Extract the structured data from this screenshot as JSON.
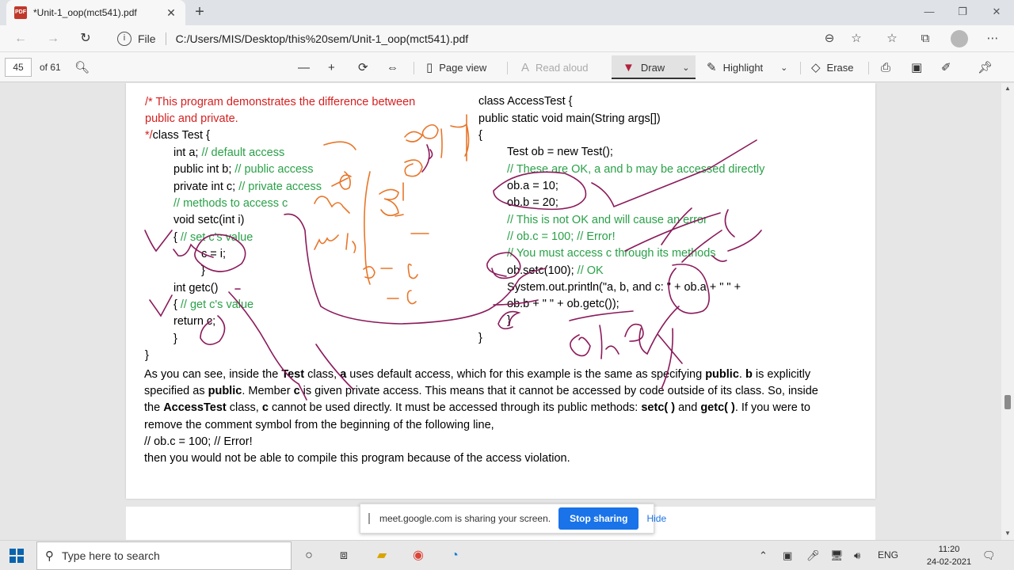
{
  "browser": {
    "tab_title": "*Unit-1_oop(mct541).pdf",
    "tab_icon": "pdf-icon",
    "file_label": "File",
    "url": "C:/Users/MIS/Desktop/this%20sem/Unit-1_oop(mct541).pdf"
  },
  "pdf_toolbar": {
    "page_number": "45",
    "page_count": "of 61",
    "page_view": "Page view",
    "read_aloud": "Read aloud",
    "draw": "Draw",
    "highlight": "Highlight",
    "erase": "Erase"
  },
  "document": {
    "left_code": [
      {
        "text": "/* This program demonstrates the difference between",
        "color": "red"
      },
      {
        "text": "public and private.",
        "color": "red"
      },
      {
        "text": "class Test {",
        "prefix": "*/",
        "color": "black"
      },
      {
        "text": "int a; ",
        "comment": "// default access"
      },
      {
        "text": "public int b; ",
        "comment": "// public access"
      },
      {
        "text": "private int c; ",
        "comment": "// private access"
      },
      {
        "text": "",
        "comment": "// methods to access c"
      },
      {
        "text": "void setc(int i)"
      },
      {
        "text": "{ ",
        "comment": "// set c's value"
      },
      {
        "text": "c = i;"
      },
      {
        "text": "}"
      },
      {
        "text": "int getc()"
      },
      {
        "text": "{ ",
        "comment": "// get c's value"
      },
      {
        "text": "return c;"
      },
      {
        "text": "}"
      },
      {
        "text": "}"
      }
    ],
    "right_code": [
      {
        "text": "class AccessTest {"
      },
      {
        "text": "public static void main(String args[])"
      },
      {
        "text": "{"
      },
      {
        "text": "Test ob = new Test();"
      },
      {
        "text": "",
        "comment": "// These are OK, a and b may be accessed directly"
      },
      {
        "text": "ob.a = 10;"
      },
      {
        "text": "ob.b = 20;"
      },
      {
        "text": "",
        "comment": "// This is not OK and will cause an error"
      },
      {
        "text": "",
        "comment": "// ob.c = 100; // Error!"
      },
      {
        "text": "",
        "comment": "// You must access c through its methods"
      },
      {
        "text": "ob.setc(100); ",
        "comment": "// OK"
      },
      {
        "text": "System.out.println(\"a, b, and c: \" + ob.a + \" \" +"
      },
      {
        "text": "ob.b + \" \" + ob.getc());"
      },
      {
        "text": "}"
      },
      {
        "text": "}"
      }
    ],
    "paragraph": {
      "p1": "As you can see, inside the ",
      "b1": "Test",
      "p2": " class, ",
      "b2": "a",
      "p3": " uses default access, which for this example is the same as specifying ",
      "b3": "public",
      "p4": ". ",
      "b4": "b",
      "p5": " is explicitly specified as ",
      "b5": "public",
      "p6": ". Member ",
      "b6": "c",
      "p7": " is given private access. This means that it cannot be accessed by code outside of its class. So, inside the ",
      "b7": "AccessTest",
      "p8": " class, ",
      "b8": "c",
      "p9": " cannot be used directly. It must be accessed through its public methods: ",
      "b9": "setc( )",
      "p10": " and ",
      "b10": "getc( )",
      "p11": ". If you were to remove the comment symbol from the beginning of the following line,",
      "line2": "// ob.c = 100; // Error!",
      "line3": "then you would not be able to compile this program because of the access violation."
    }
  },
  "share_banner": {
    "message": "meet.google.com is sharing your screen.",
    "stop": "Stop sharing",
    "hide": "Hide"
  },
  "taskbar": {
    "search_placeholder": "Type here to search",
    "language": "ENG",
    "time": "11:20",
    "date": "24-02-2021"
  },
  "colors": {
    "code_comment": "#2aa148",
    "code_red": "#d62020",
    "ink_purple": "#8b1a5a",
    "ink_orange": "#e8762a",
    "accent": "#1a73e8"
  }
}
